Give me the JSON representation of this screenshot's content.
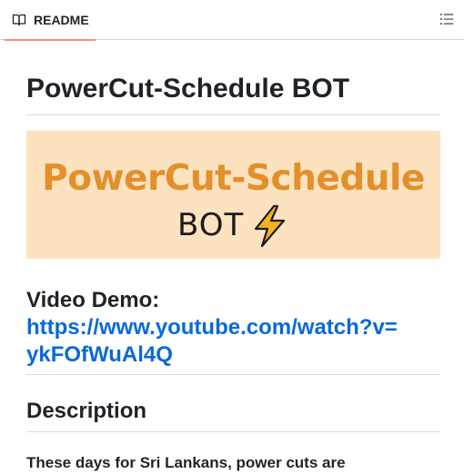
{
  "header": {
    "tab_label": "README",
    "tab_icon": "book-icon",
    "toc_icon": "list-unordered-icon",
    "accent_color": "#fd8c73"
  },
  "readme": {
    "title": "PowerCut-Schedule BOT",
    "banner": {
      "title": "PowerCut-Schedule",
      "subtitle": "BOT",
      "icon": "lightning-bolt-icon",
      "background": "#fde2c0",
      "title_color": "#e3902a"
    },
    "video_demo": {
      "heading": "Video Demo:",
      "link": "https://www.youtube.com/watch?v=ykFOfWuAl4Q"
    },
    "description": {
      "heading": "Description",
      "text": "These days for Sri Lankans, power cuts are"
    }
  }
}
